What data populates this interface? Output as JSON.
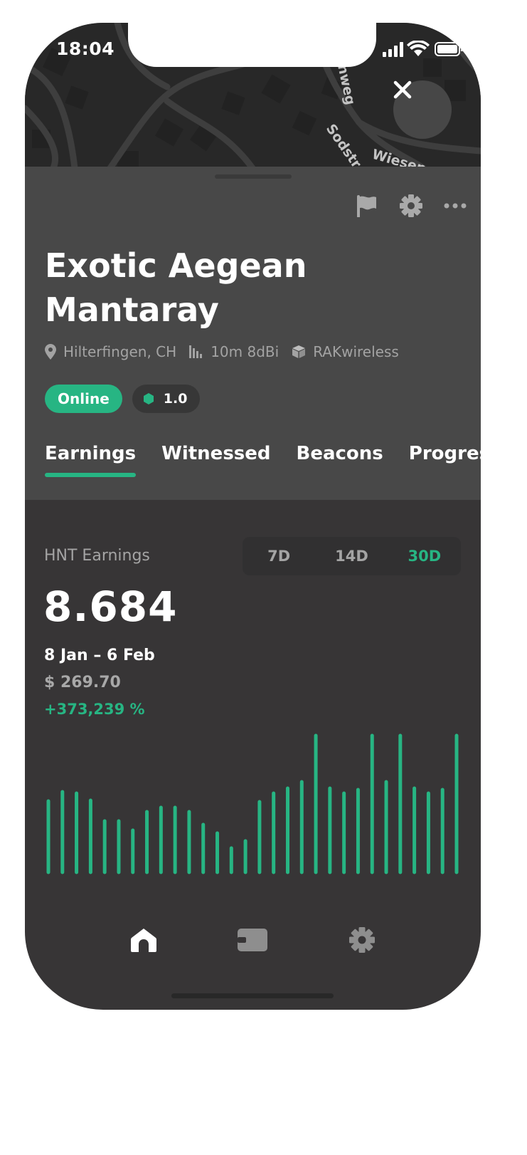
{
  "status_bar": {
    "time": "18:04"
  },
  "map": {
    "street_labels": [
      "nweg",
      "Sodstr",
      "Wiesen"
    ]
  },
  "hotspot": {
    "name": "Exotic Aegean Mantaray",
    "location": "Hilterfingen, CH",
    "antenna": "10m 8dBi",
    "maker": "RAKwireless",
    "status": "Online",
    "reward_scale": "1.0"
  },
  "toolbar_icons": [
    "flag-icon",
    "gear-icon",
    "more-icon"
  ],
  "tabs": [
    {
      "label": "Earnings",
      "active": true
    },
    {
      "label": "Witnessed",
      "active": false
    },
    {
      "label": "Beacons",
      "active": false
    },
    {
      "label": "Progress",
      "active": false
    }
  ],
  "earnings": {
    "label": "HNT Earnings",
    "ranges": [
      "7D",
      "14D",
      "30D"
    ],
    "selected_range": "30D",
    "total": "8.684",
    "date_range": "8 Jan – 6 Feb",
    "usd": "$ 269.70",
    "change": "+373,239 %"
  },
  "chart_data": {
    "type": "bar",
    "values": [
      100,
      113,
      111,
      101,
      72,
      72,
      59,
      85,
      91,
      91,
      85,
      67,
      55,
      34,
      44,
      99,
      111,
      118,
      127,
      192,
      118,
      111,
      116,
      192,
      127,
      192,
      118,
      111,
      116,
      192
    ],
    "bar_color": "#27b583"
  },
  "bottom_nav": [
    {
      "name": "home-icon",
      "active": true
    },
    {
      "name": "wallet-icon",
      "active": false
    },
    {
      "name": "settings-icon",
      "active": false
    }
  ],
  "colors": {
    "accent": "#27b583",
    "sheet": "#484848",
    "background": "#373536"
  }
}
